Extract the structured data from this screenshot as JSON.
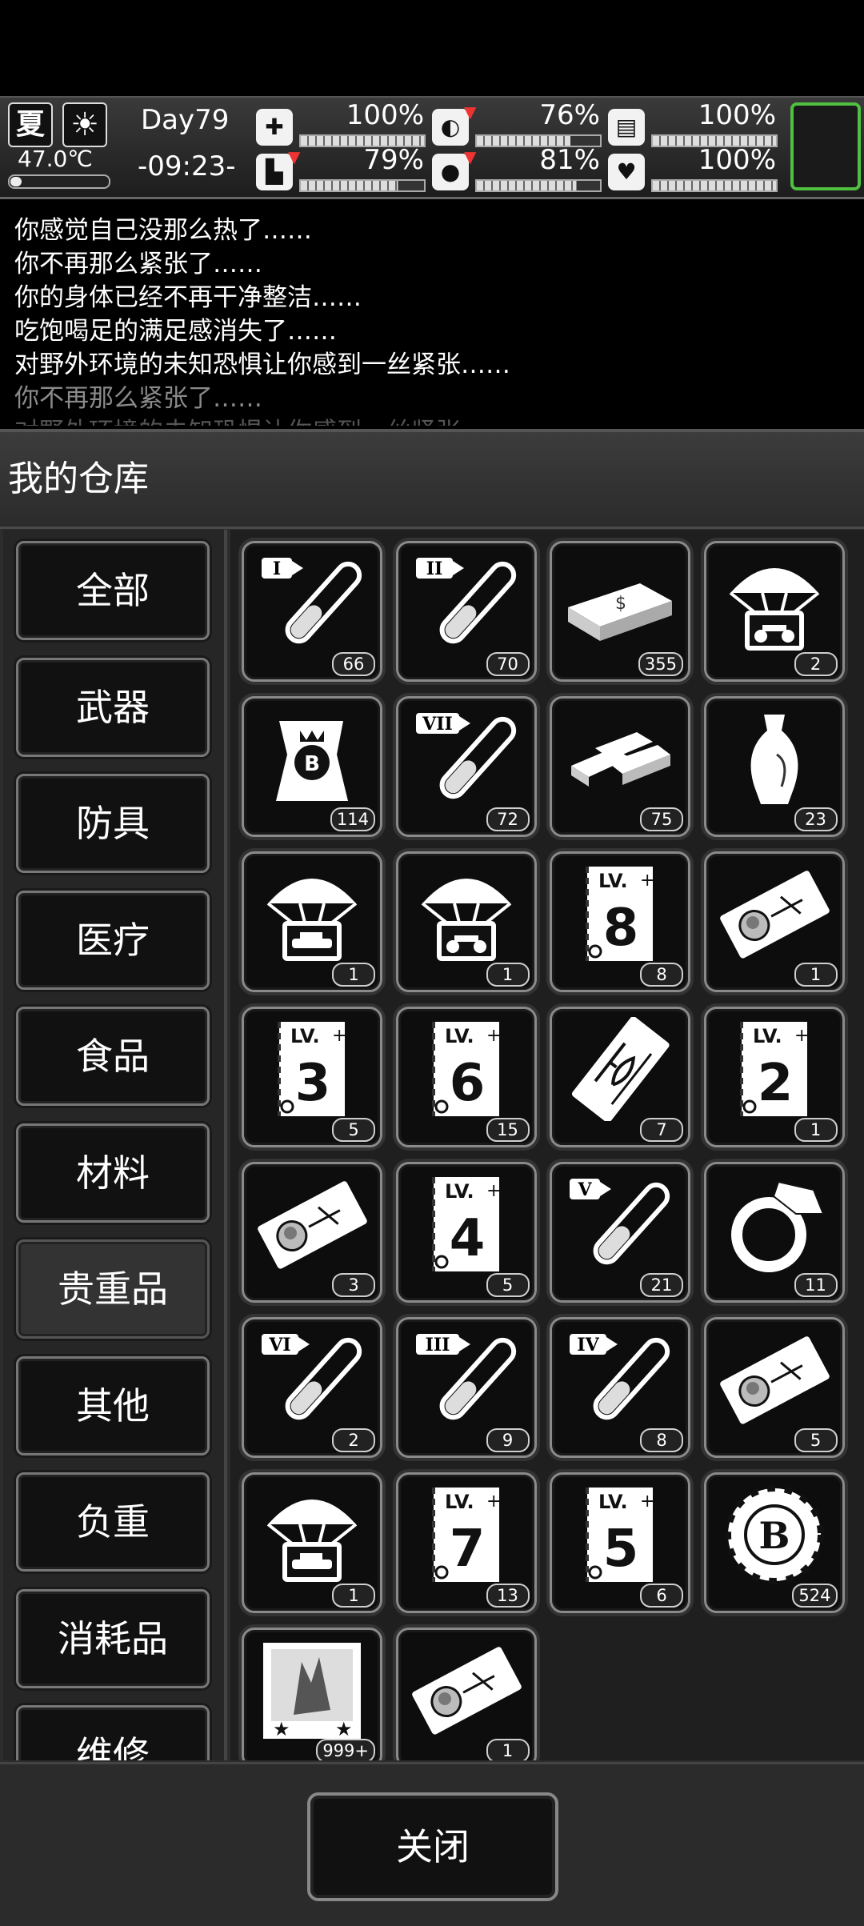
{
  "status": {
    "season": "夏",
    "weather_icon": "sun-icon",
    "temperature": "47.0℃",
    "day": "Day79",
    "time": "-09:23-",
    "stats": [
      {
        "name": "health",
        "icon": "medkit-icon",
        "value": "100%",
        "fill": 1.0,
        "down": false
      },
      {
        "name": "hunger",
        "icon": "stomach-icon",
        "value": "76%",
        "fill": 0.76,
        "down": true
      },
      {
        "name": "hygiene",
        "icon": "jar-icon",
        "value": "100%",
        "fill": 1.0,
        "down": false
      },
      {
        "name": "stamina",
        "icon": "boot-icon",
        "value": "79%",
        "fill": 0.79,
        "down": true
      },
      {
        "name": "thirst",
        "icon": "water-drop-icon",
        "value": "81%",
        "fill": 0.81,
        "down": true
      },
      {
        "name": "mood",
        "icon": "heart-icon",
        "value": "100%",
        "fill": 1.0,
        "down": false
      }
    ]
  },
  "log": [
    "你感觉自己没那么热了……",
    "你不再那么紧张了……",
    "你的身体已经不再干净整洁……",
    "吃饱喝足的满足感消失了……",
    "对野外环境的未知恐惧让你感到一丝紧张……",
    "你不再那么紧张了……",
    "对野外环境的未知恐惧让你感到一丝紧张"
  ],
  "panel": {
    "title": "我的仓库",
    "close_label": "关闭"
  },
  "categories": [
    "全部",
    "武器",
    "防具",
    "医疗",
    "食品",
    "材料",
    "贵重品",
    "其他",
    "负重",
    "消耗品",
    "维修"
  ],
  "active_category": "贵重品",
  "items": [
    {
      "icon": "tube",
      "label": "I",
      "count": "66"
    },
    {
      "icon": "tube",
      "label": "II",
      "count": "70"
    },
    {
      "icon": "cash-stack",
      "label": "",
      "count": "355"
    },
    {
      "icon": "parachute-bike",
      "label": "",
      "count": "2"
    },
    {
      "icon": "bitcoin-bag",
      "label": "",
      "count": "114"
    },
    {
      "icon": "tube",
      "label": "VII",
      "count": "72"
    },
    {
      "icon": "gold-bars",
      "label": "",
      "count": "75"
    },
    {
      "icon": "vase",
      "label": "",
      "count": "23"
    },
    {
      "icon": "parachute-car",
      "label": "",
      "count": "1"
    },
    {
      "icon": "parachute-bike",
      "label": "",
      "count": "1"
    },
    {
      "icon": "level-book",
      "label": "8",
      "count": "8"
    },
    {
      "icon": "ticket-avatar",
      "label": "",
      "count": "1"
    },
    {
      "icon": "level-book",
      "label": "3",
      "count": "5"
    },
    {
      "icon": "level-book",
      "label": "6",
      "count": "15"
    },
    {
      "icon": "ticket-heli",
      "label": "",
      "count": "7"
    },
    {
      "icon": "level-book",
      "label": "2",
      "count": "1"
    },
    {
      "icon": "ticket-avatar",
      "label": "",
      "count": "3"
    },
    {
      "icon": "level-book",
      "label": "4",
      "count": "5"
    },
    {
      "icon": "tube",
      "label": "V",
      "count": "21"
    },
    {
      "icon": "ring",
      "label": "",
      "count": "11"
    },
    {
      "icon": "tube",
      "label": "VI",
      "count": "2"
    },
    {
      "icon": "tube",
      "label": "III",
      "count": "9"
    },
    {
      "icon": "tube",
      "label": "IV",
      "count": "8"
    },
    {
      "icon": "ticket-avatar",
      "label": "",
      "count": "5"
    },
    {
      "icon": "parachute-car",
      "label": "",
      "count": "1"
    },
    {
      "icon": "level-book",
      "label": "7",
      "count": "13"
    },
    {
      "icon": "level-book",
      "label": "5",
      "count": "6"
    },
    {
      "icon": "bitcoin-chip",
      "label": "",
      "count": "524"
    },
    {
      "icon": "zombie-card",
      "label": "",
      "count": "999+"
    },
    {
      "icon": "ticket-avatar",
      "label": "",
      "count": "1"
    }
  ]
}
